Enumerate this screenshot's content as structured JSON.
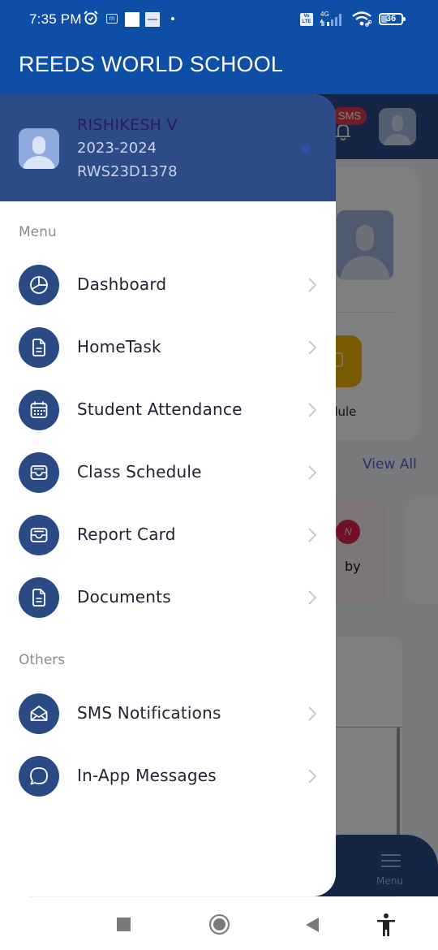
{
  "status_bar": {
    "time": "7:35 PM",
    "icons": [
      "alarm-icon",
      "m-app-icon",
      "white-square-notification",
      "news-notification",
      "dot-indicator",
      "volte-icon",
      "signal-4g-icon",
      "wifi-icon",
      "battery-icon"
    ],
    "volte_label": "Vo LTE",
    "network_label": "4G",
    "battery_level": "36"
  },
  "app_bar": {
    "title": "REEDS WORLD SCHOOL"
  },
  "drawer": {
    "profile": {
      "name": "RISHIKESH V",
      "academic_year": "2023-2024",
      "student_id": "RWS23D1378"
    },
    "sections": [
      {
        "label": "Menu",
        "items": [
          {
            "label": "Dashboard",
            "icon": "pie-chart-icon"
          },
          {
            "label": "HomeTask",
            "icon": "document-icon"
          },
          {
            "label": "Student Attendance",
            "icon": "calendar-icon"
          },
          {
            "label": "Class Schedule",
            "icon": "inbox-tray-icon"
          },
          {
            "label": "Report Card",
            "icon": "inbox-tray-icon"
          },
          {
            "label": "Documents",
            "icon": "document-icon"
          }
        ]
      },
      {
        "label": "Others",
        "items": [
          {
            "label": "SMS Notifications",
            "icon": "envelope-open-icon"
          },
          {
            "label": "In-App Messages",
            "icon": "chat-bubble-icon"
          }
        ]
      }
    ]
  },
  "background": {
    "sms_badge": "SMS",
    "tile_label": "chedule",
    "view_all": "View All",
    "notice_badge": "N",
    "notice_text": "by",
    "bottom_nav_label": "Menu"
  },
  "colors": {
    "app_bar": "#0d4ea6",
    "drawer_header": "#2d4b86",
    "icon_circle": "#2a4a86",
    "sms_badge": "#e03a4f",
    "tile_yellow": "#f5b400",
    "view_all": "#5660d8"
  },
  "system_nav": {
    "buttons": [
      "recent-apps",
      "home",
      "back",
      "accessibility"
    ]
  }
}
